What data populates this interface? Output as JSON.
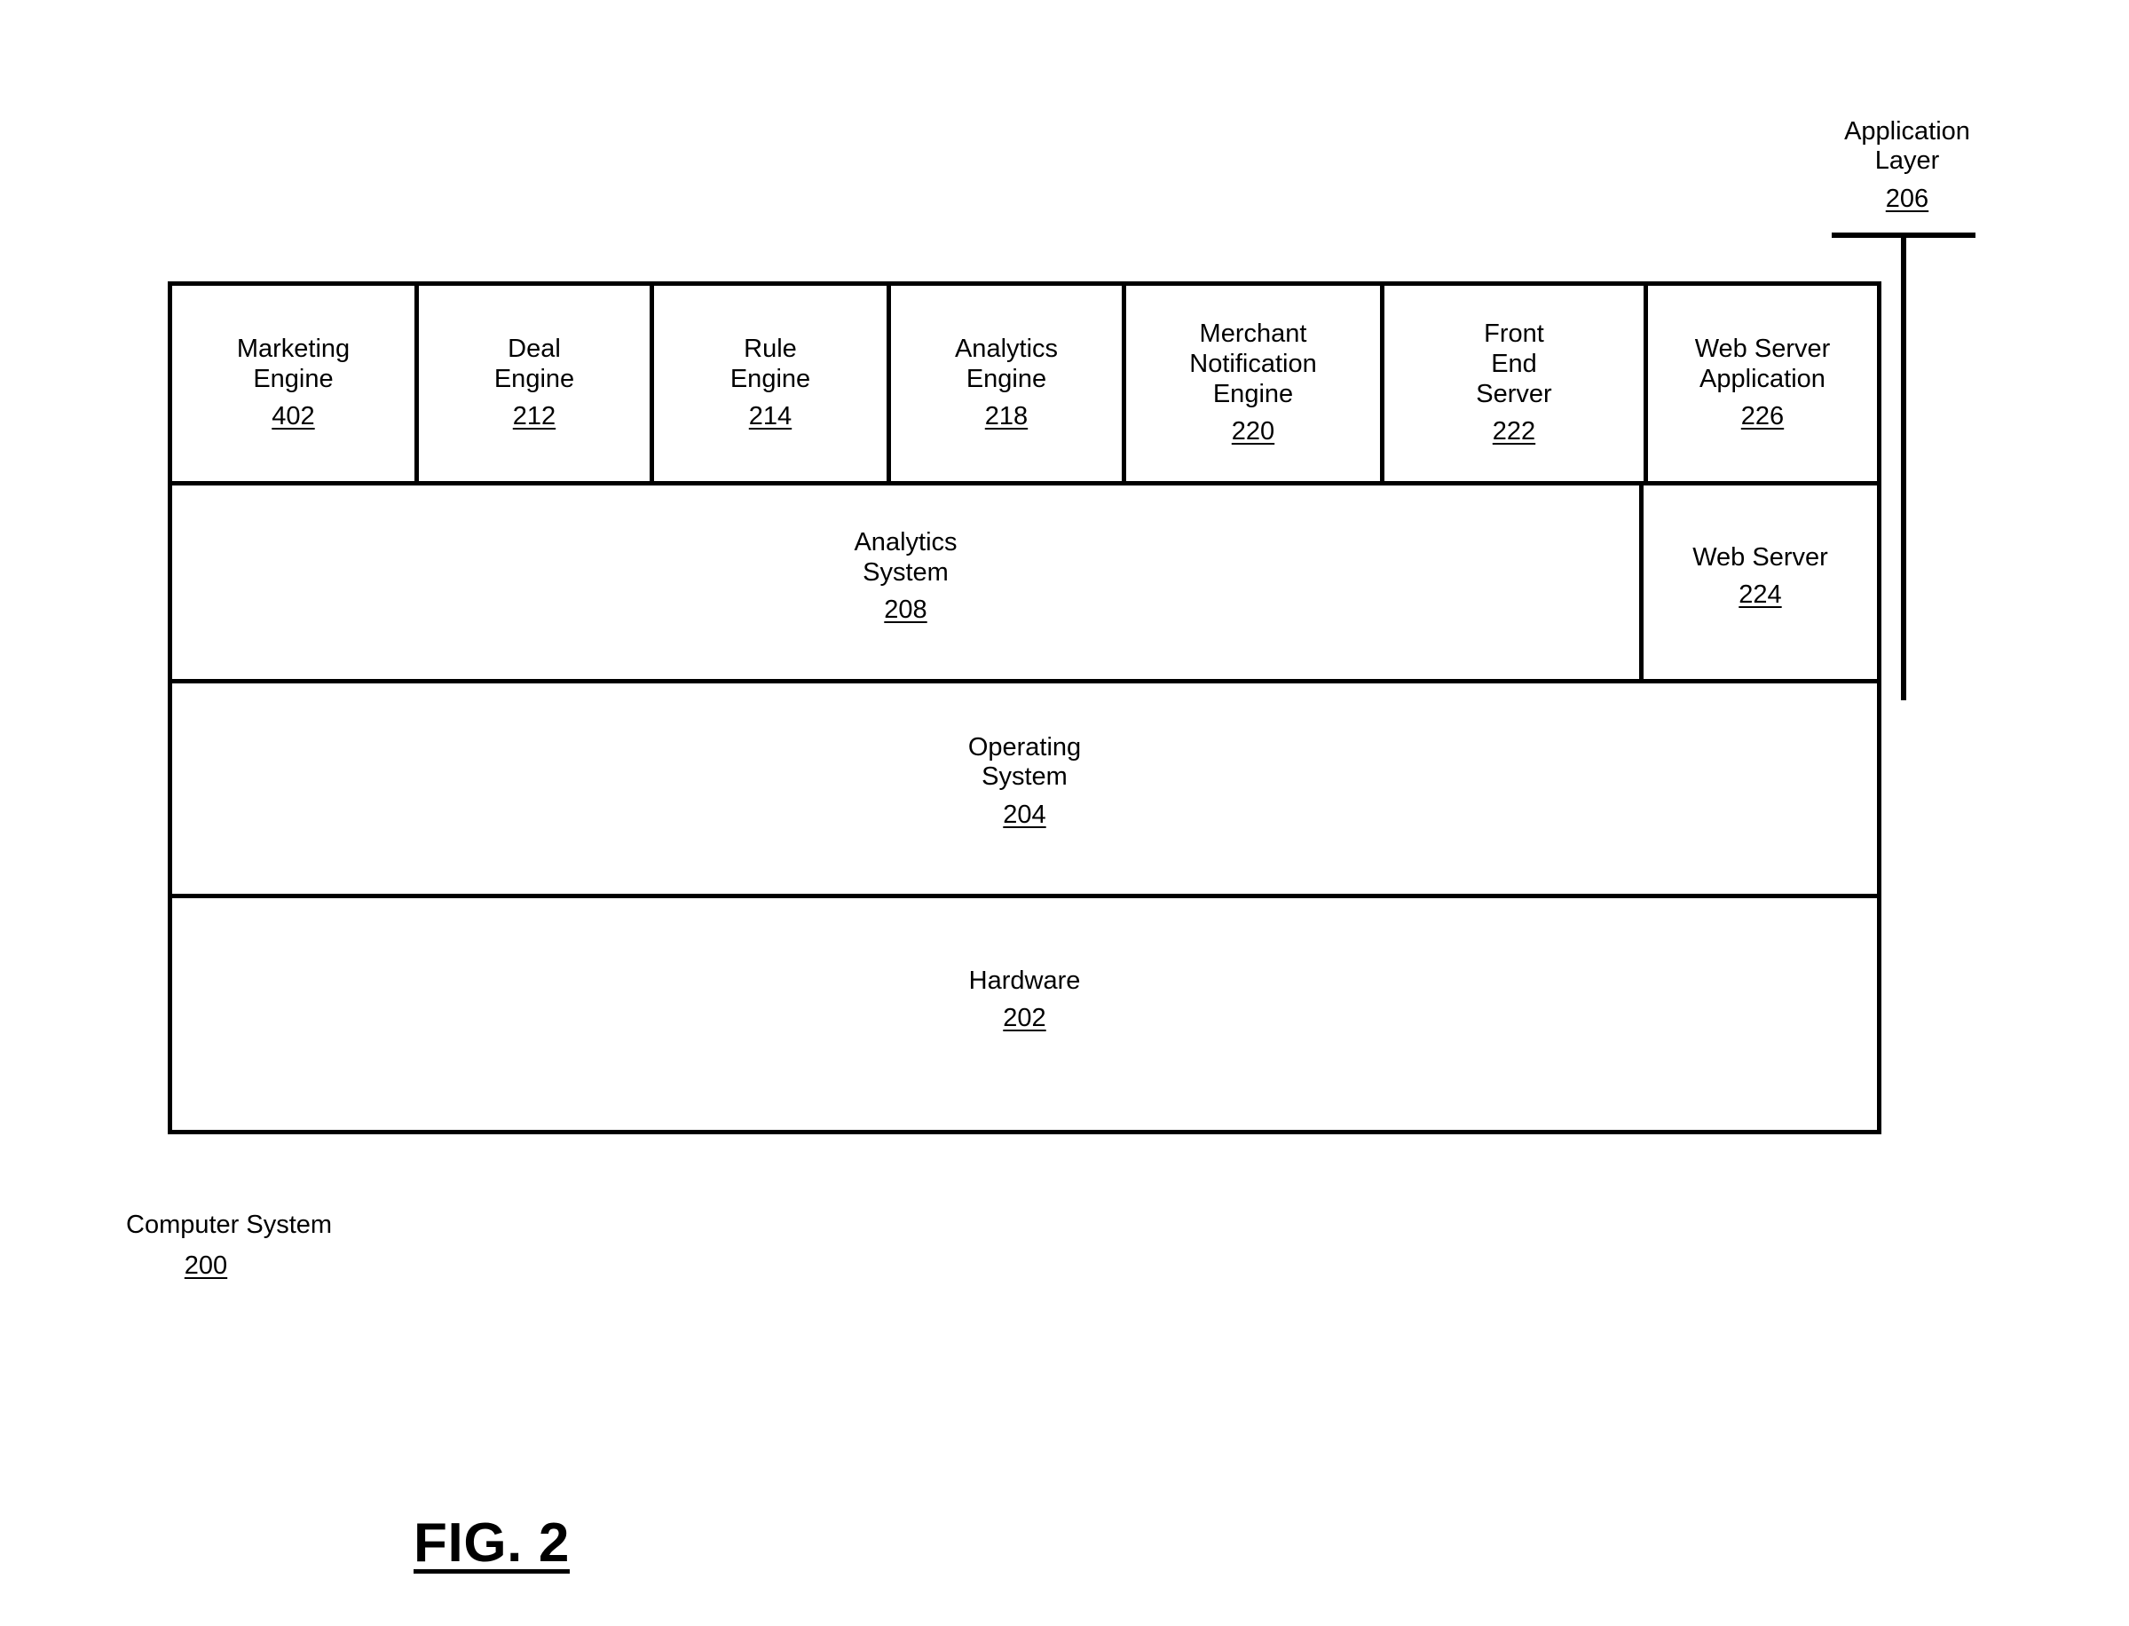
{
  "figure": {
    "caption": "FIG. 2",
    "computer_system": {
      "name": "Computer System",
      "ref": "200"
    },
    "application_layer": {
      "name": "Application\nLayer",
      "ref": "206"
    }
  },
  "stack": {
    "engine_row": [
      {
        "name": "Marketing\nEngine",
        "ref": "402"
      },
      {
        "name": "Deal\nEngine",
        "ref": "212"
      },
      {
        "name": "Rule\nEngine",
        "ref": "214"
      },
      {
        "name": "Analytics\nEngine",
        "ref": "218"
      },
      {
        "name": "Merchant\nNotification\nEngine",
        "ref": "220"
      },
      {
        "name": "Front\nEnd\nServer",
        "ref": "222"
      },
      {
        "name": "Web Server\nApplication",
        "ref": "226"
      }
    ],
    "analytics_row": [
      {
        "name": "Analytics\nSystem",
        "ref": "208"
      },
      {
        "name": "Web Server",
        "ref": "224"
      }
    ],
    "os_row": {
      "name": "Operating\nSystem",
      "ref": "204"
    },
    "hardware_row": {
      "name": "Hardware",
      "ref": "202"
    }
  },
  "colors": {
    "line": "#000000",
    "background": "#ffffff",
    "text": "#000000"
  }
}
